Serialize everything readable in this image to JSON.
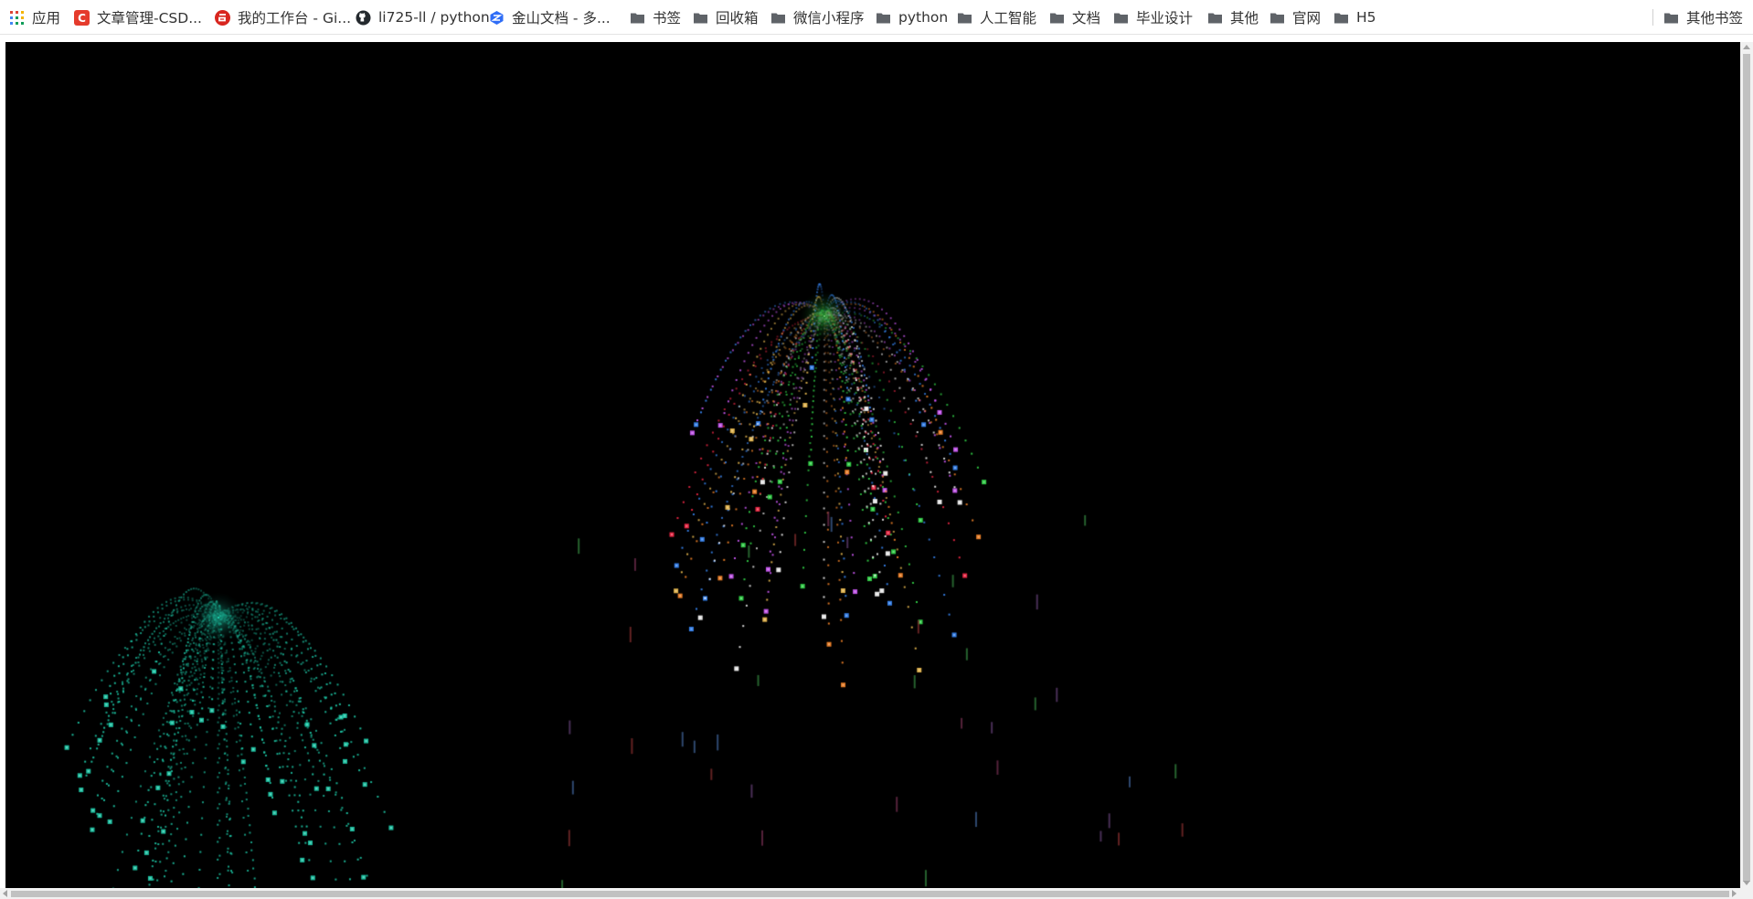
{
  "bookmarks_bar": {
    "apps_label": "应用",
    "items": [
      {
        "label": "文章管理-CSD...",
        "icon": "csdn-icon",
        "color": "#e53b2c"
      },
      {
        "label": "我的工作台 - Gi...",
        "icon": "gitee-icon",
        "color": "#d8261f"
      },
      {
        "label": "li725-ll / python",
        "icon": "github-icon",
        "color": "#24292e"
      },
      {
        "label": "金山文档 - 多...",
        "icon": "kdocs-icon",
        "color": "#2f6df6"
      }
    ],
    "folders": [
      {
        "label": "书签"
      },
      {
        "label": "回收箱"
      },
      {
        "label": "微信小程序"
      },
      {
        "label": "python"
      },
      {
        "label": "人工智能"
      },
      {
        "label": "文档"
      },
      {
        "label": "毕业设计"
      },
      {
        "label": "其他"
      },
      {
        "label": "官网"
      },
      {
        "label": "H5"
      }
    ],
    "other_bookmarks": "其他书签"
  },
  "page": {
    "background": "#000000"
  },
  "fireworks": [
    {
      "style": "single-color",
      "colors": [
        "#1fd3b0"
      ]
    },
    {
      "style": "multi-color",
      "colors": [
        "#35e04c",
        "#d45cff",
        "#ff2a4a",
        "#f6c454",
        "#ffffff",
        "#3a8cff",
        "#ff8a2a"
      ]
    }
  ]
}
